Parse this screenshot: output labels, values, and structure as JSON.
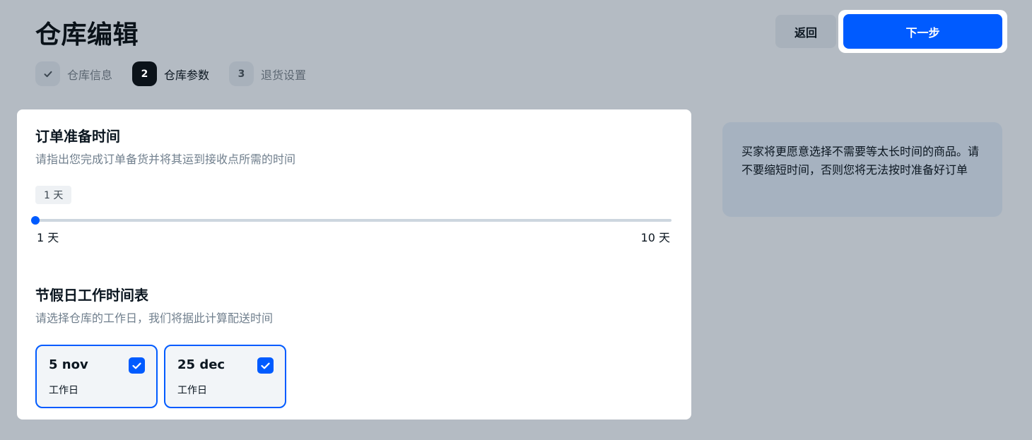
{
  "header": {
    "title": "仓库编辑",
    "back_label": "返回",
    "next_label": "下一步"
  },
  "steps": [
    {
      "number": "",
      "label": "仓库信息",
      "state": "done",
      "icon": "check-icon"
    },
    {
      "number": "2",
      "label": "仓库参数",
      "state": "active"
    },
    {
      "number": "3",
      "label": "退货设置",
      "state": "todo"
    }
  ],
  "prep_time": {
    "title": "订单准备时间",
    "subtitle": "请指出您完成订单备货并将其运到接收点所需的时间",
    "current_value": "1 天",
    "min_label": "1 天",
    "max_label": "10 天",
    "min": 1,
    "max": 10,
    "value": 1
  },
  "holiday": {
    "title": "节假日工作时间表",
    "subtitle": "请选择仓库的工作日，我们将据此计算配送时间",
    "days": [
      {
        "date": "5 nov",
        "label": "工作日",
        "checked": true
      },
      {
        "date": "25 dec",
        "label": "工作日",
        "checked": true
      }
    ]
  },
  "hint": {
    "text": "买家将更愿意选择不需要等太长时间的商品。请不要缩短时间，否则您将无法按时准备好订单"
  },
  "colors": {
    "accent": "#005bff",
    "background": "#b4bbc3",
    "hint_background": "#a6b2c0"
  }
}
